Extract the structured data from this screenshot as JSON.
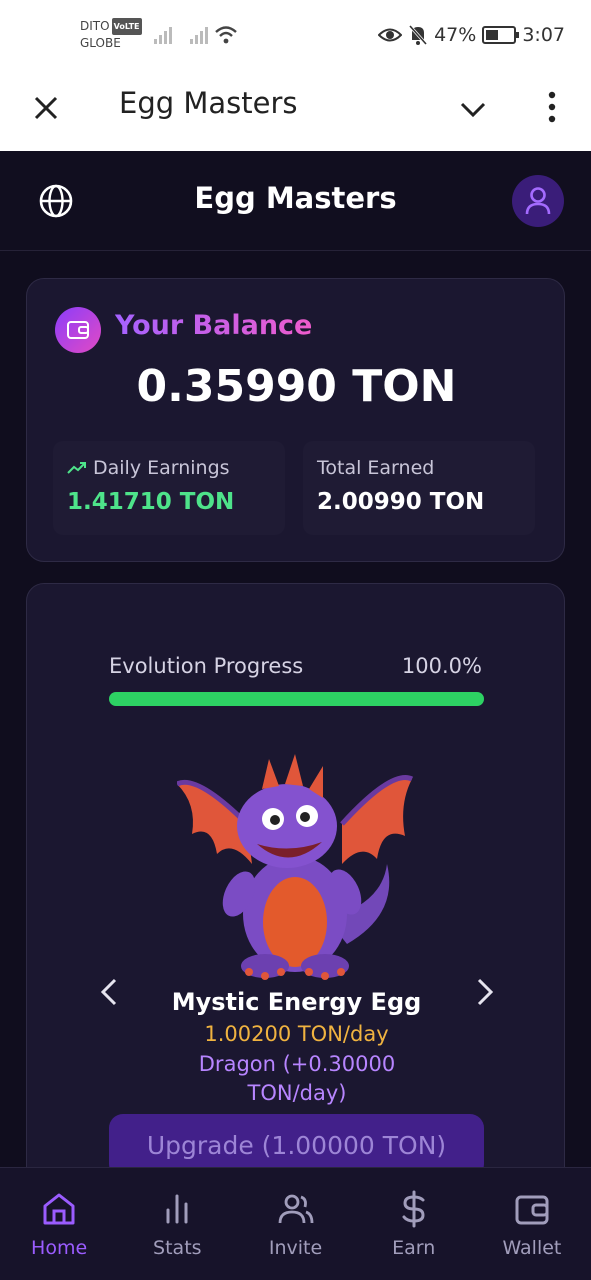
{
  "status_bar": {
    "carrier_line1": "DITO",
    "volte_badge": "VoLTE",
    "carrier_line2": "GLOBE",
    "battery_percent": "47%",
    "time": "3:07"
  },
  "app_bar": {
    "title": "Egg Masters"
  },
  "header": {
    "title": "Egg Masters"
  },
  "balance": {
    "label": "Your Balance",
    "amount": "0.35990 TON",
    "daily_label": "Daily Earnings",
    "daily_value": "1.41710 TON",
    "total_label": "Total Earned",
    "total_value": "2.00990 TON"
  },
  "evolution": {
    "progress_label": "Evolution Progress",
    "progress_text": "100.0%",
    "progress_fraction": 1.0,
    "egg_name": "Mystic Energy Egg",
    "egg_rate": "1.00200 TON/day",
    "egg_bonus": "Dragon (+0.30000 TON/day)",
    "upgrade_label": "Upgrade (1.00000 TON)"
  },
  "nav": {
    "items": [
      {
        "label": "Home",
        "icon": "home-icon",
        "active": true
      },
      {
        "label": "Stats",
        "icon": "bar-chart-icon",
        "active": false
      },
      {
        "label": "Invite",
        "icon": "users-icon",
        "active": false
      },
      {
        "label": "Earn",
        "icon": "dollar-icon",
        "active": false
      },
      {
        "label": "Wallet",
        "icon": "wallet-icon",
        "active": false
      }
    ]
  },
  "colors": {
    "background": "#100d1e",
    "card": "#1b1730",
    "accent_purple": "#9b5cff",
    "earnings_green": "#4ee38a",
    "progress_green": "#2dd163",
    "rate_orange": "#f0b340"
  }
}
